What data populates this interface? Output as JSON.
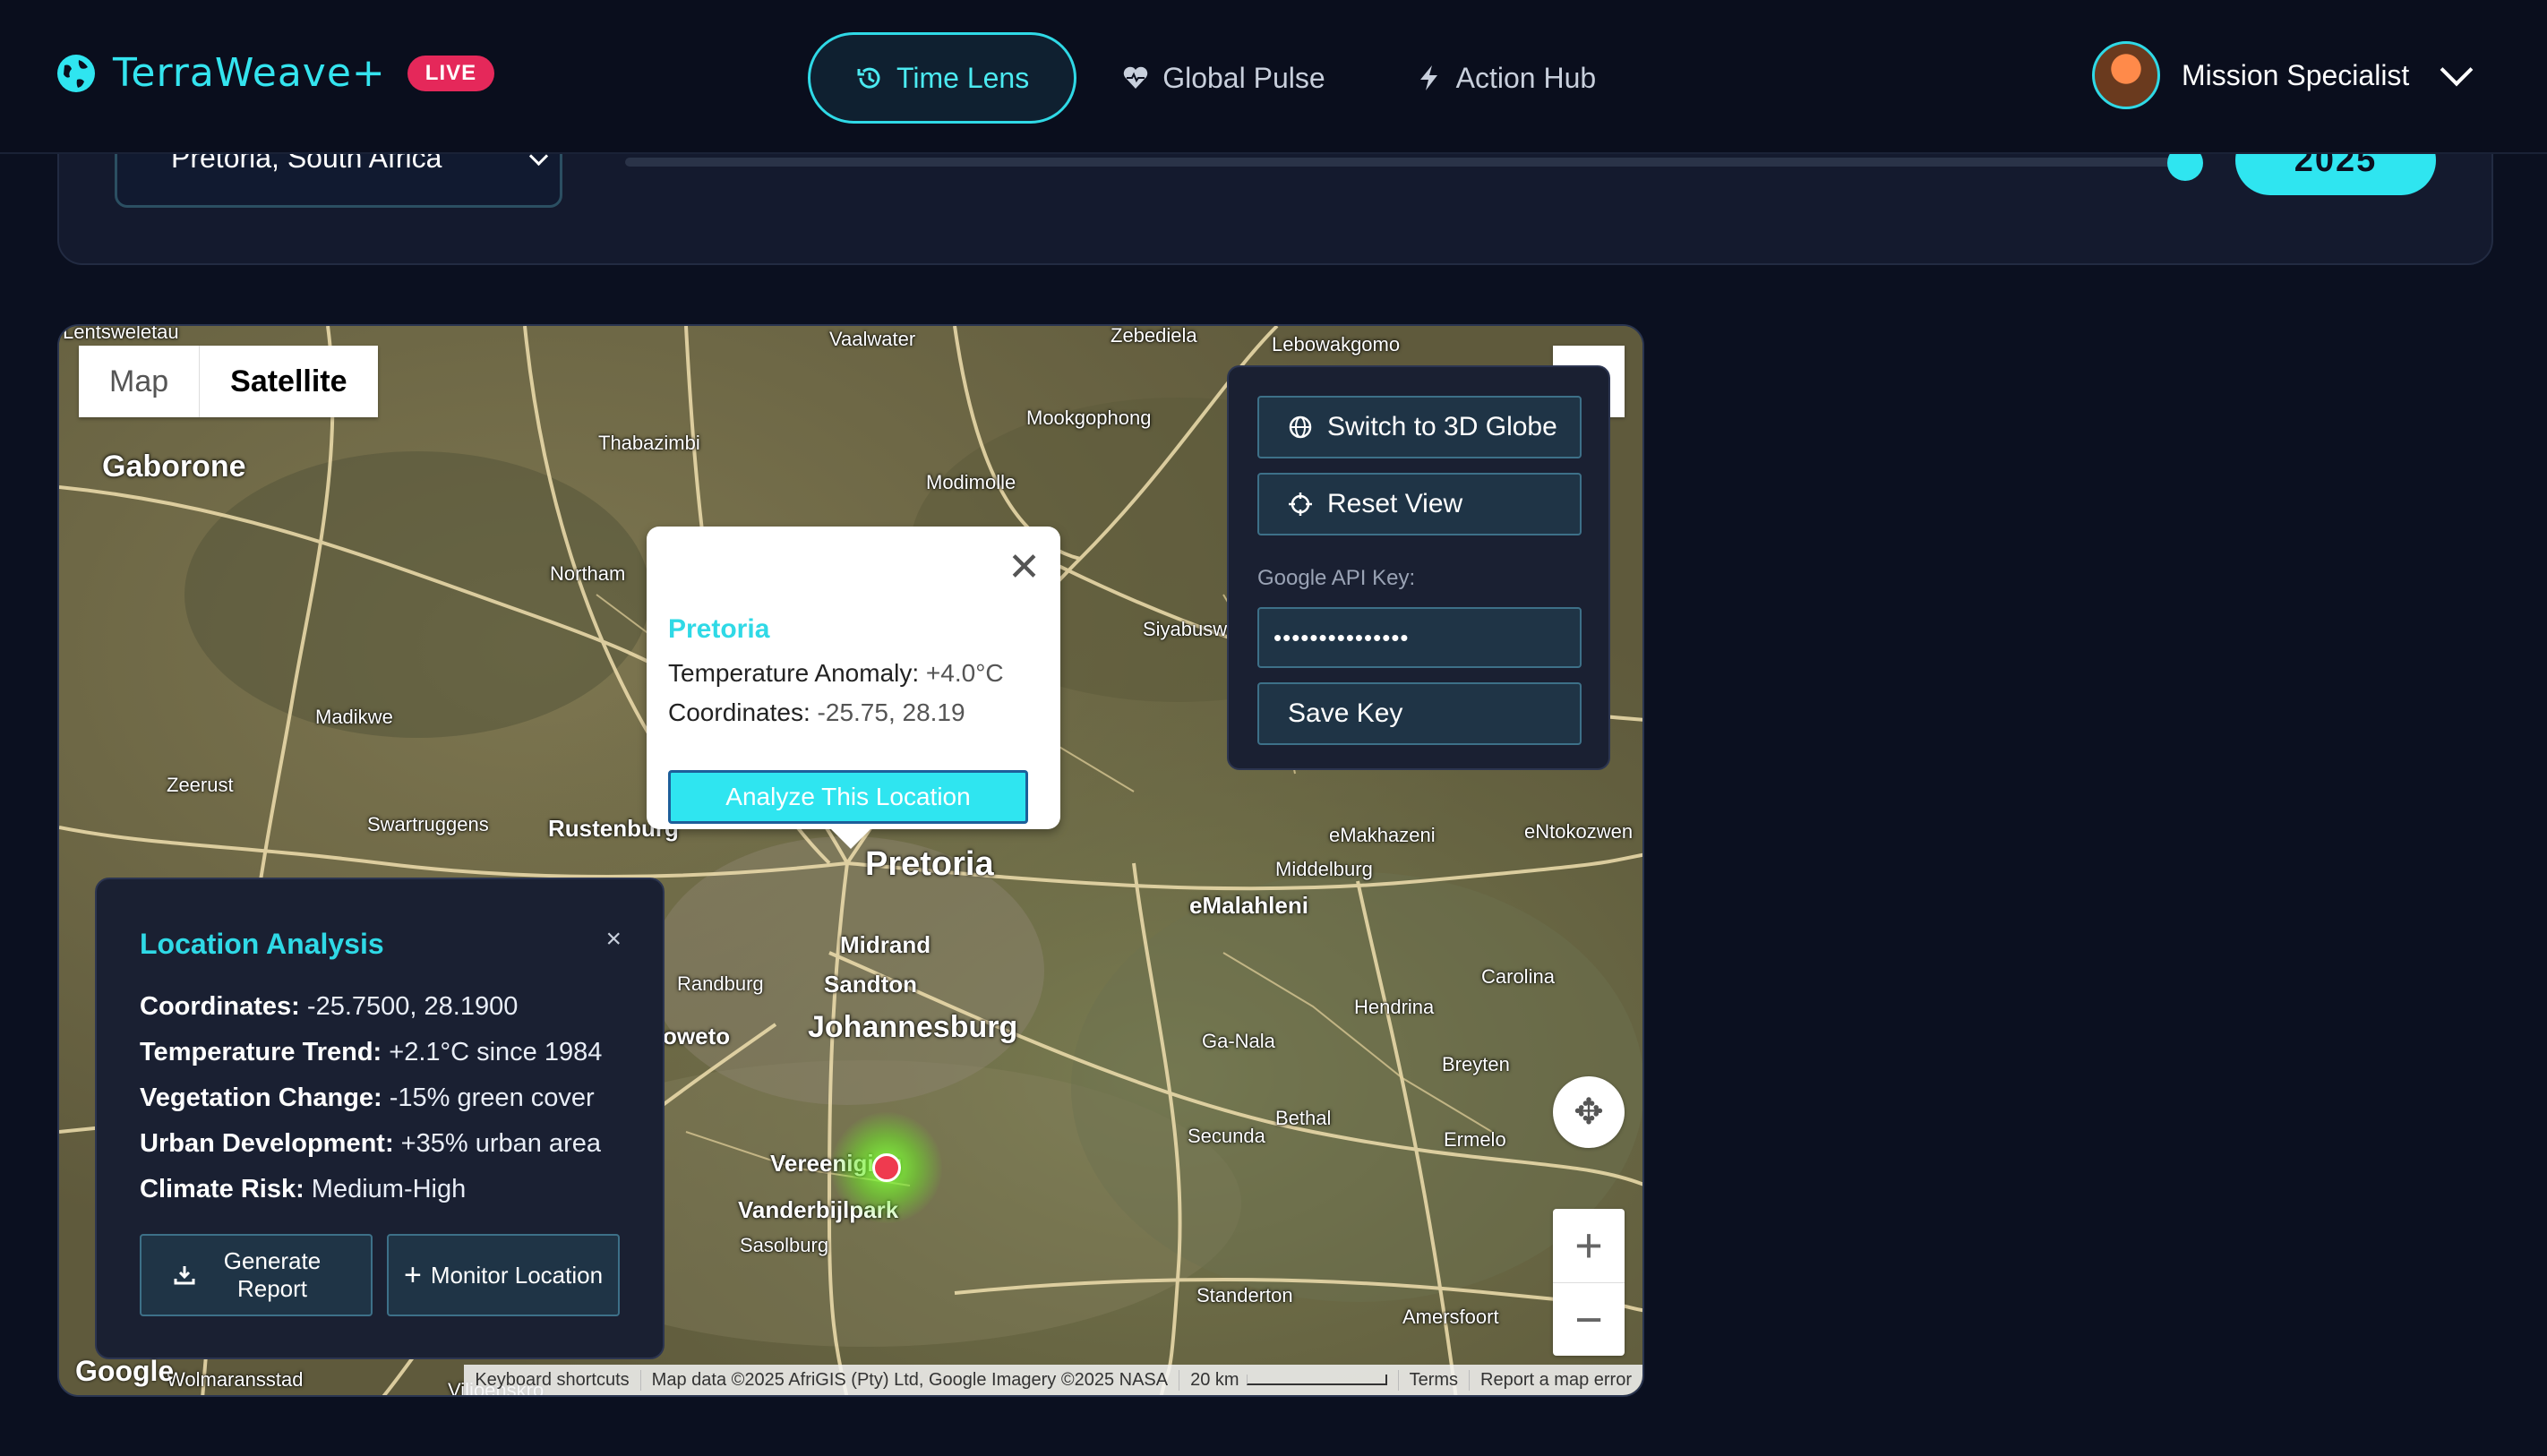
{
  "header": {
    "brand_name": "TerraWeave+",
    "live_badge": "LIVE",
    "nav": [
      {
        "label": "Time Lens",
        "icon": "history-icon",
        "active": true
      },
      {
        "label": "Global Pulse",
        "icon": "heart-pulse-icon",
        "active": false
      },
      {
        "label": "Action Hub",
        "icon": "lightning-icon",
        "active": false
      }
    ],
    "user": {
      "name": "Mission Specialist"
    }
  },
  "controls": {
    "location_select": "Pretoria, South Africa",
    "year": "2025"
  },
  "map": {
    "type_buttons": {
      "map": "Map",
      "satellite": "Satellite"
    },
    "places": {
      "lentswe": "Lentsweletau",
      "vaalwater": "Vaalwater",
      "zebediela": "Zebediela",
      "lebowakgomo": "Lebowakgomo",
      "gaborone": "Gaborone",
      "thabazimbi": "Thabazimbi",
      "mookgophong": "Mookgophong",
      "modimolle": "Modimolle",
      "northam": "Northam",
      "siyabuswa": "Siyabusw",
      "madikwe": "Madikwe",
      "zeerust": "Zeerust",
      "swartruggens": "Swartruggens",
      "rustenburg": "Rustenburg",
      "pretoria": "Pretoria",
      "emakhazeni": "eMakhazeni",
      "entokozweni": "eNtokozwen",
      "middelburg": "Middelburg",
      "emalahleni": "eMalahleni",
      "midrand": "Midrand",
      "randburg": "Randburg",
      "sandton": "Sandton",
      "soweto": "oweto",
      "johannesburg": "Johannesburg",
      "carolina": "Carolina",
      "ganala": "Ga-Nala",
      "hendrina": "Hendrina",
      "breyten": "Breyten",
      "bethal": "Bethal",
      "secunda": "Secunda",
      "ermelo": "Ermelo",
      "vereeniging": "Vereeniging",
      "vanderbijlpark": "Vanderbijlpark",
      "sasolburg": "Sasolburg",
      "standerton": "Standerton",
      "amersfoort": "Amersfoort",
      "wolmaransstad": "Wolmaransstad",
      "viljoenskroon": "Viljoenskro"
    },
    "attribution": {
      "shortcuts": "Keyboard shortcuts",
      "data": "Map data ©2025 AfriGIS (Pty) Ltd, Google Imagery ©2025 NASA",
      "scale": "20 km",
      "terms": "Terms",
      "report": "Report a map error"
    },
    "google_logo": "Google"
  },
  "popup": {
    "title": "Pretoria",
    "temp_label": "Temperature Anomaly:",
    "temp_value": "+4.0°C",
    "coord_label": "Coordinates:",
    "coord_value": "-25.75, 28.19",
    "button": "Analyze This Location"
  },
  "control_panel": {
    "switch_3d": "Switch to 3D Globe",
    "reset_view": "Reset View",
    "api_label": "Google API Key:",
    "api_value": "•••••••••••••••",
    "save_key": "Save Key"
  },
  "analysis": {
    "title": "Location Analysis",
    "close": "×",
    "rows": [
      {
        "label": "Coordinates:",
        "value": "-25.7500, 28.1900"
      },
      {
        "label": "Temperature Trend:",
        "value": "+2.1°C since 1984"
      },
      {
        "label": "Vegetation Change:",
        "value": "-15% green cover"
      },
      {
        "label": "Urban Development:",
        "value": "+35% urban area"
      },
      {
        "label": "Climate Risk:",
        "value": "Medium-High"
      }
    ],
    "generate_report": "Generate Report",
    "monitor_location": "Monitor Location"
  }
}
